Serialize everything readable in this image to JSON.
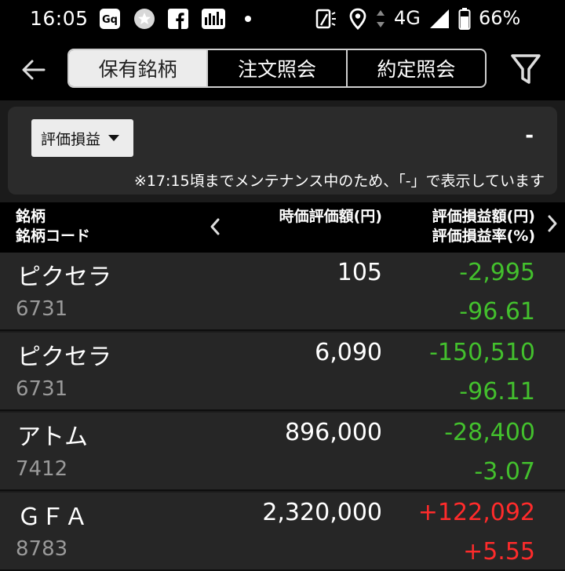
{
  "status_bar": {
    "time": "16:05",
    "network": "4G",
    "battery": "66%",
    "icons": [
      "auto-icon",
      "star-badge-icon",
      "facebook-icon",
      "chart-app-icon",
      "dot-icon",
      "screen-rotate-icon",
      "location-icon",
      "data-arrows-icon",
      "signal-icon",
      "battery-icon"
    ]
  },
  "nav": {
    "tabs": [
      {
        "label": "保有銘柄",
        "active": true
      },
      {
        "label": "注文照会",
        "active": false
      },
      {
        "label": "約定照会",
        "active": false
      }
    ]
  },
  "summary": {
    "dropdown_label": "評価損益",
    "value": "-",
    "notice": "※17:15頃までメンテナンス中のため、「-」で表示しています"
  },
  "table_header": {
    "col1_line1": "銘柄",
    "col1_line2": "銘柄コード",
    "col2": "時価評価額(円)",
    "col3_line1": "評価損益額(円)",
    "col3_line2": "評価損益率(%)"
  },
  "holdings": [
    {
      "name": "ピクセラ",
      "code": "6731",
      "market_value": "105",
      "pl_amount": "-2,995",
      "pl_rate": "-96.61",
      "sign": "neg"
    },
    {
      "name": "ピクセラ",
      "code": "6731",
      "market_value": "6,090",
      "pl_amount": "-150,510",
      "pl_rate": "-96.11",
      "sign": "neg"
    },
    {
      "name": "アトム",
      "code": "7412",
      "market_value": "896,000",
      "pl_amount": "-28,400",
      "pl_rate": "-3.07",
      "sign": "neg"
    },
    {
      "name": "ＧＦＡ",
      "code": "8783",
      "market_value": "2,320,000",
      "pl_amount": "+122,092",
      "pl_rate": "+5.55",
      "sign": "pos"
    }
  ],
  "colors": {
    "negative": "#43c02d",
    "positive": "#ff2b2b"
  }
}
